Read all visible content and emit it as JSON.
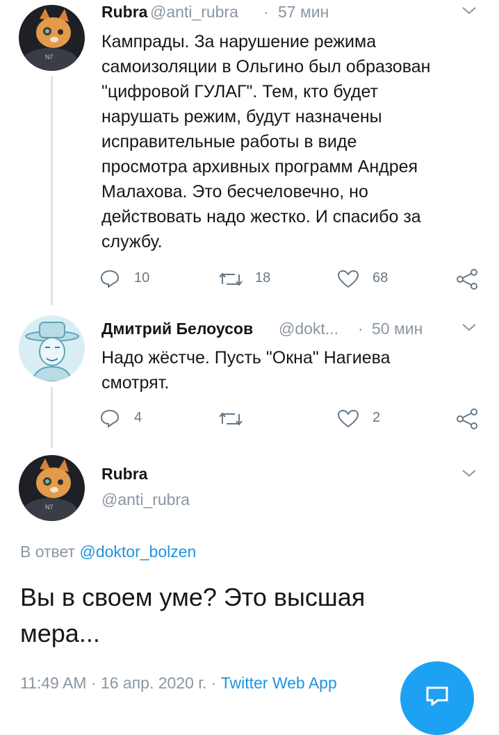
{
  "tweet1": {
    "name": "Rubra",
    "handle": "@anti_rubra",
    "sep": "·",
    "time": "57 мин",
    "lines": [
      "Кампрады. За нарушение режима",
      "самоизоляции в Ольгино был образован",
      "\"цифровой ГУЛАГ\". Тем, кто будет",
      "нарушать режим, будут назначены",
      "исправительные работы в виде",
      "просмотра архивных программ Андрея",
      "Малахова. Это бесчеловечно, но",
      "действовать надо жестко. И спасибо за",
      "службу."
    ],
    "replies": "10",
    "retweets": "18",
    "likes": "68"
  },
  "tweet2": {
    "name": "Дмитрий Белоусов",
    "handle": "@dokt...",
    "sep": "·",
    "time": "50 мин",
    "lines": [
      "Надо жёстче. Пусть \"Окна\" Нагиева",
      "смотрят."
    ],
    "replies": "4",
    "likes": "2"
  },
  "main": {
    "name": "Rubra",
    "handle": "@anti_rubra",
    "reply_prefix": "В ответ",
    "reply_to": "@doktor_bolzen",
    "text_lines": [
      "Вы в своем уме? Это высшая",
      "мера..."
    ],
    "time": "11:49 AM",
    "sep1": "·",
    "date": "16 апр. 2020 г.",
    "sep2": "·",
    "source": "Twitter Web App"
  },
  "colors": {
    "accent": "#1da1f2",
    "link": "#1b95e0",
    "secondary": "#8a96a3"
  },
  "icons": [
    "reply-icon",
    "retweet-icon",
    "like-icon",
    "share-icon",
    "chevron-down-icon",
    "compose-fab-icon"
  ]
}
